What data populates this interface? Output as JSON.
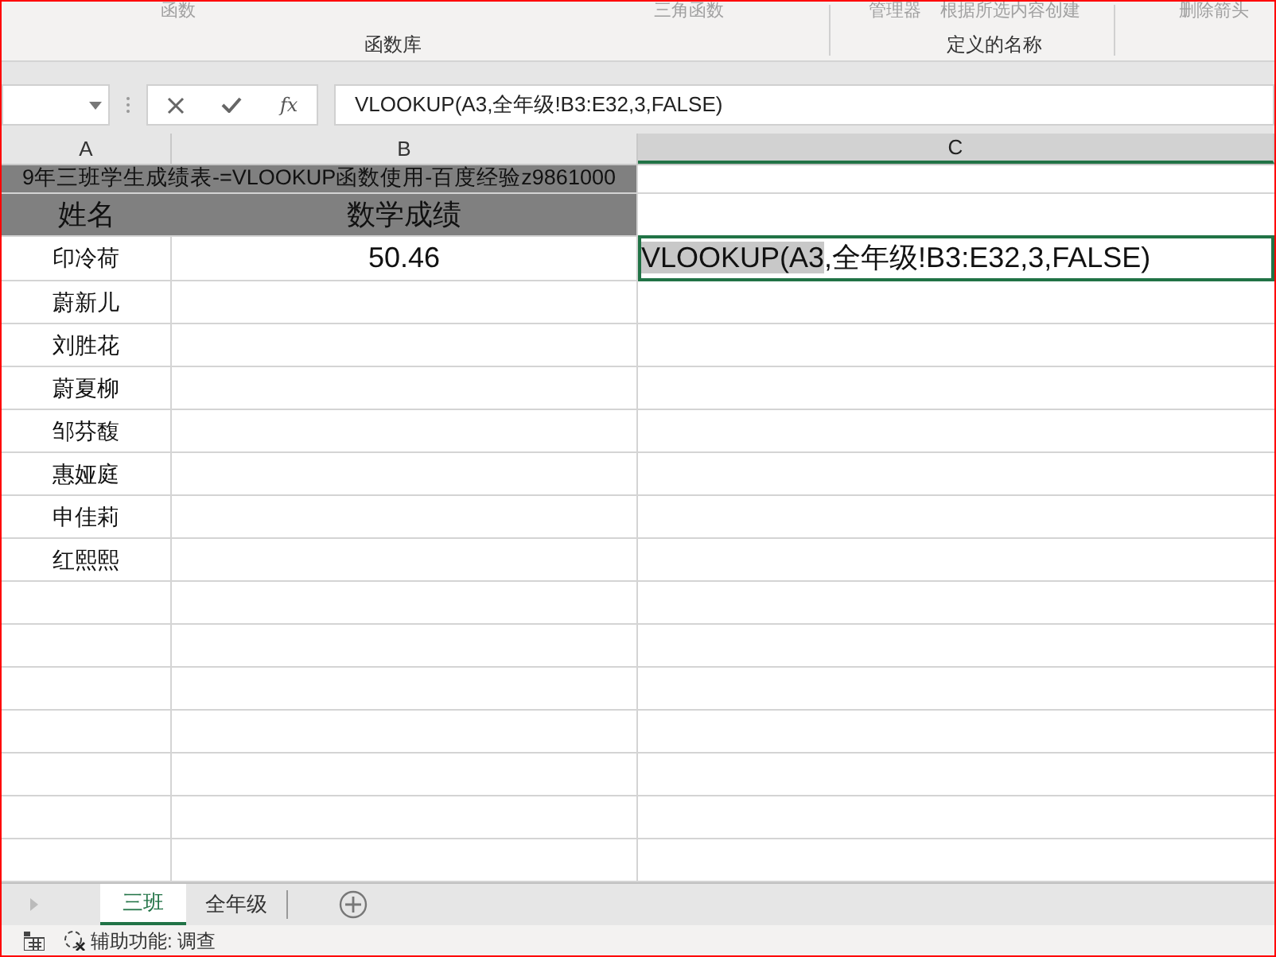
{
  "ribbon": {
    "buttons": [
      {
        "label": "函数"
      },
      {
        "label": "三角函数"
      },
      {
        "label": "管理器"
      },
      {
        "label": "根据所选内容创建"
      },
      {
        "label": "删除箭头"
      }
    ],
    "groups": [
      "函数库",
      "定义的名称"
    ]
  },
  "formula_bar": {
    "fx": "fx",
    "formula": "VLOOKUP(A3,全年级!B3:E32,3,FALSE)"
  },
  "columns": [
    {
      "label": "A",
      "selected": false
    },
    {
      "label": "B",
      "selected": false
    },
    {
      "label": "C",
      "selected": true
    }
  ],
  "sheet": {
    "title": "9年三班学生成绩表-=VLOOKUP函数使用-百度经验z9861000",
    "headers": [
      "姓名",
      "数学成绩"
    ],
    "rows": [
      {
        "name": "印冷荷",
        "score": "50.46"
      },
      {
        "name": "蔚新儿"
      },
      {
        "name": "刘胜花"
      },
      {
        "name": "蔚夏柳"
      },
      {
        "name": "邹芬馥"
      },
      {
        "name": "惠娅庭"
      },
      {
        "name": "申佳莉"
      },
      {
        "name": "红熙熙"
      }
    ],
    "editing": {
      "highlighted": "VLOOKUP(A3",
      "rest": ",全年级!B3:E32,3,FALSE)"
    }
  },
  "tabs": [
    {
      "label": "三班",
      "selected": true
    },
    {
      "label": "全年级",
      "selected": false
    }
  ],
  "status_bar": {
    "accessibility": "辅助功能: 调查"
  }
}
